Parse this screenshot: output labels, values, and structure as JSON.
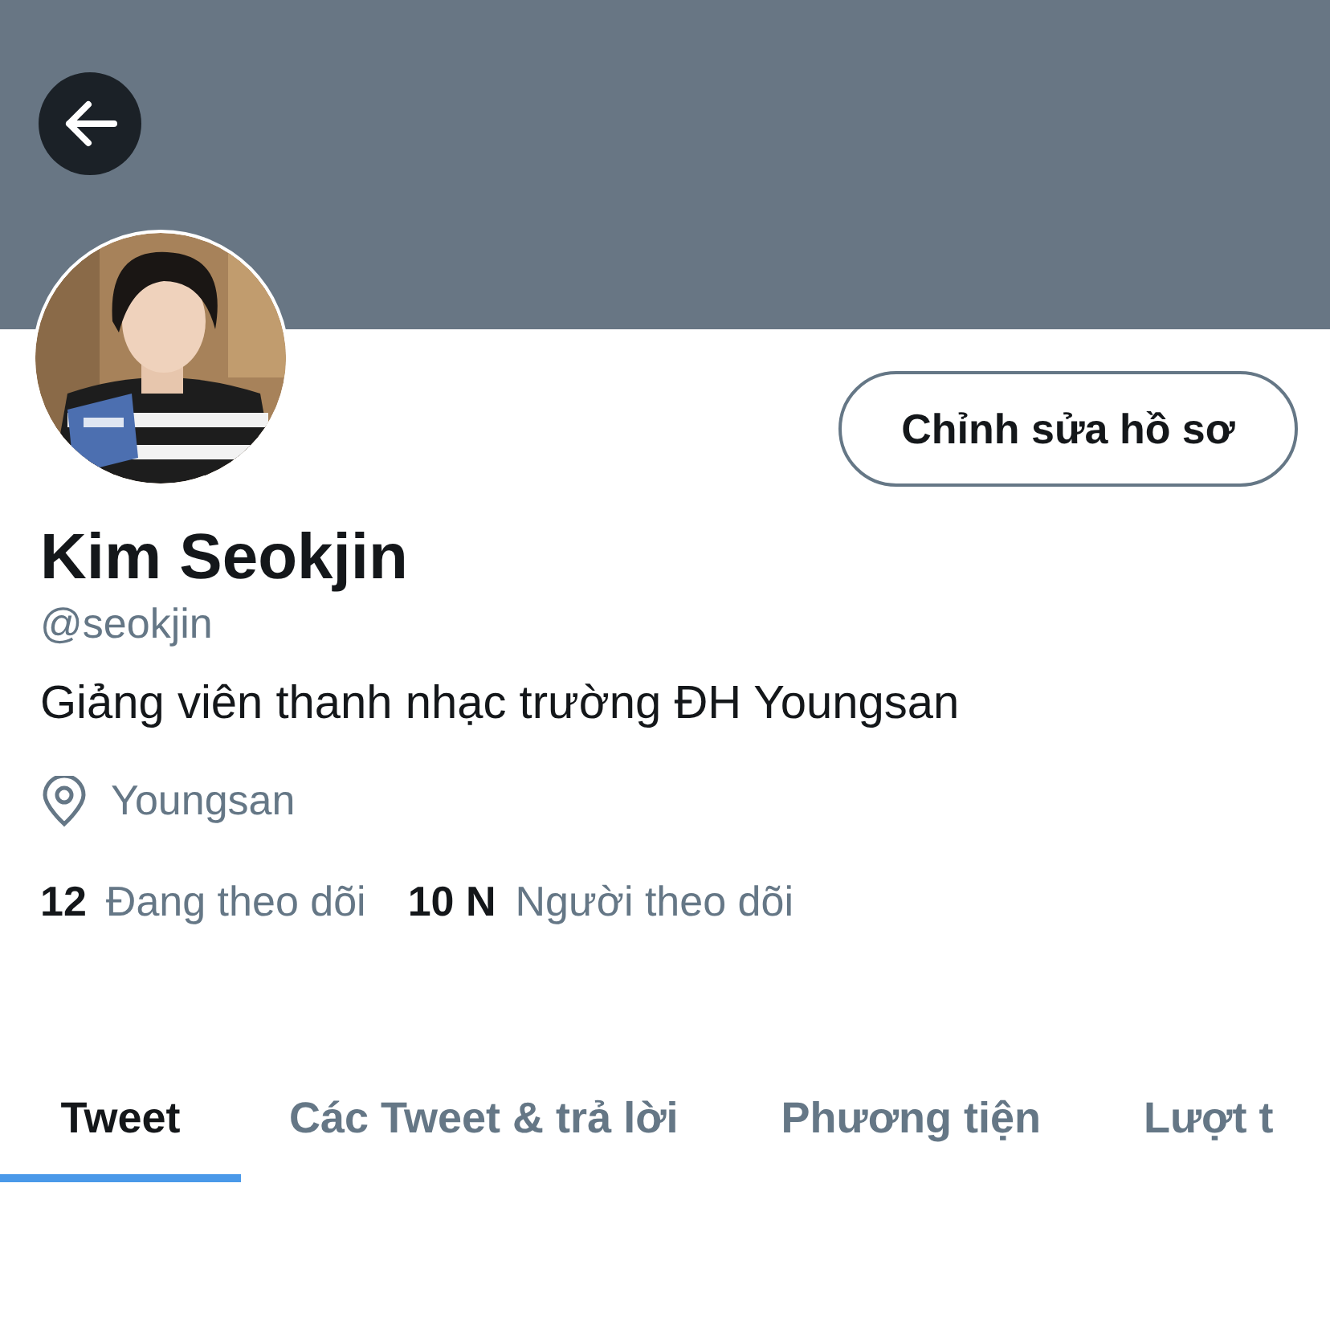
{
  "profile": {
    "name": "Kim Seokjin",
    "handle": "@seokjin",
    "bio": "Giảng viên thanh nhạc trường ĐH Youngsan",
    "location": "Youngsan"
  },
  "edit_button": "Chỉnh sửa hồ sơ",
  "stats": [
    {
      "count": "12",
      "label": "Đang theo dõi"
    },
    {
      "count": "10 N",
      "label": "Người theo dõi"
    }
  ],
  "tabs": [
    {
      "label": "Tweet",
      "selected": true
    },
    {
      "label": "Các Tweet & trả lời",
      "selected": false
    },
    {
      "label": "Phương tiện",
      "selected": false
    },
    {
      "label": "Lượt t",
      "selected": false
    }
  ]
}
